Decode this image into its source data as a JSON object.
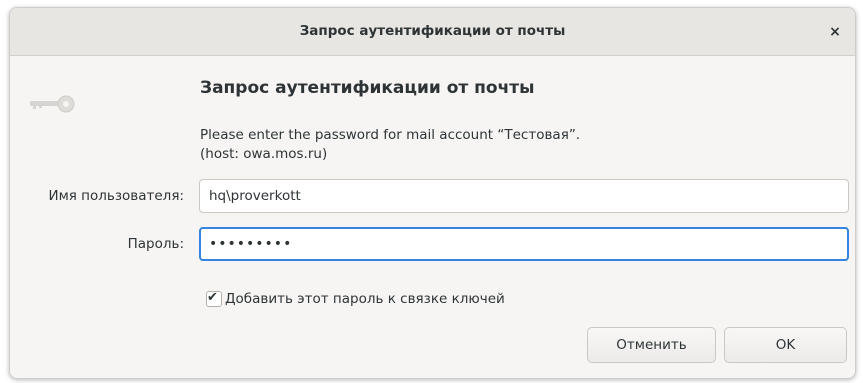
{
  "window": {
    "title": "Запрос аутентификации от почты",
    "close_symbol": "×"
  },
  "dialog": {
    "icon": "key-icon",
    "heading": "Запрос аутентификации от почты",
    "message_line1": "Please enter the password for mail account “Тестовая”.",
    "message_line2": "(host: owa.mos.ru)",
    "username_label": "Имя пользователя:",
    "username_value": "hq\\proverkott",
    "password_label": "Пароль:",
    "password_value": "•••••••••",
    "remember_checked": true,
    "remember_label": "Добавить этот пароль к связке ключей",
    "cancel_label": "Отменить",
    "ok_label": "OK"
  },
  "colors": {
    "focus_accent": "#3584e4",
    "window_bg": "#f6f5f4",
    "titlebar_bg": "#e8e6e3",
    "text": "#2e3436"
  }
}
